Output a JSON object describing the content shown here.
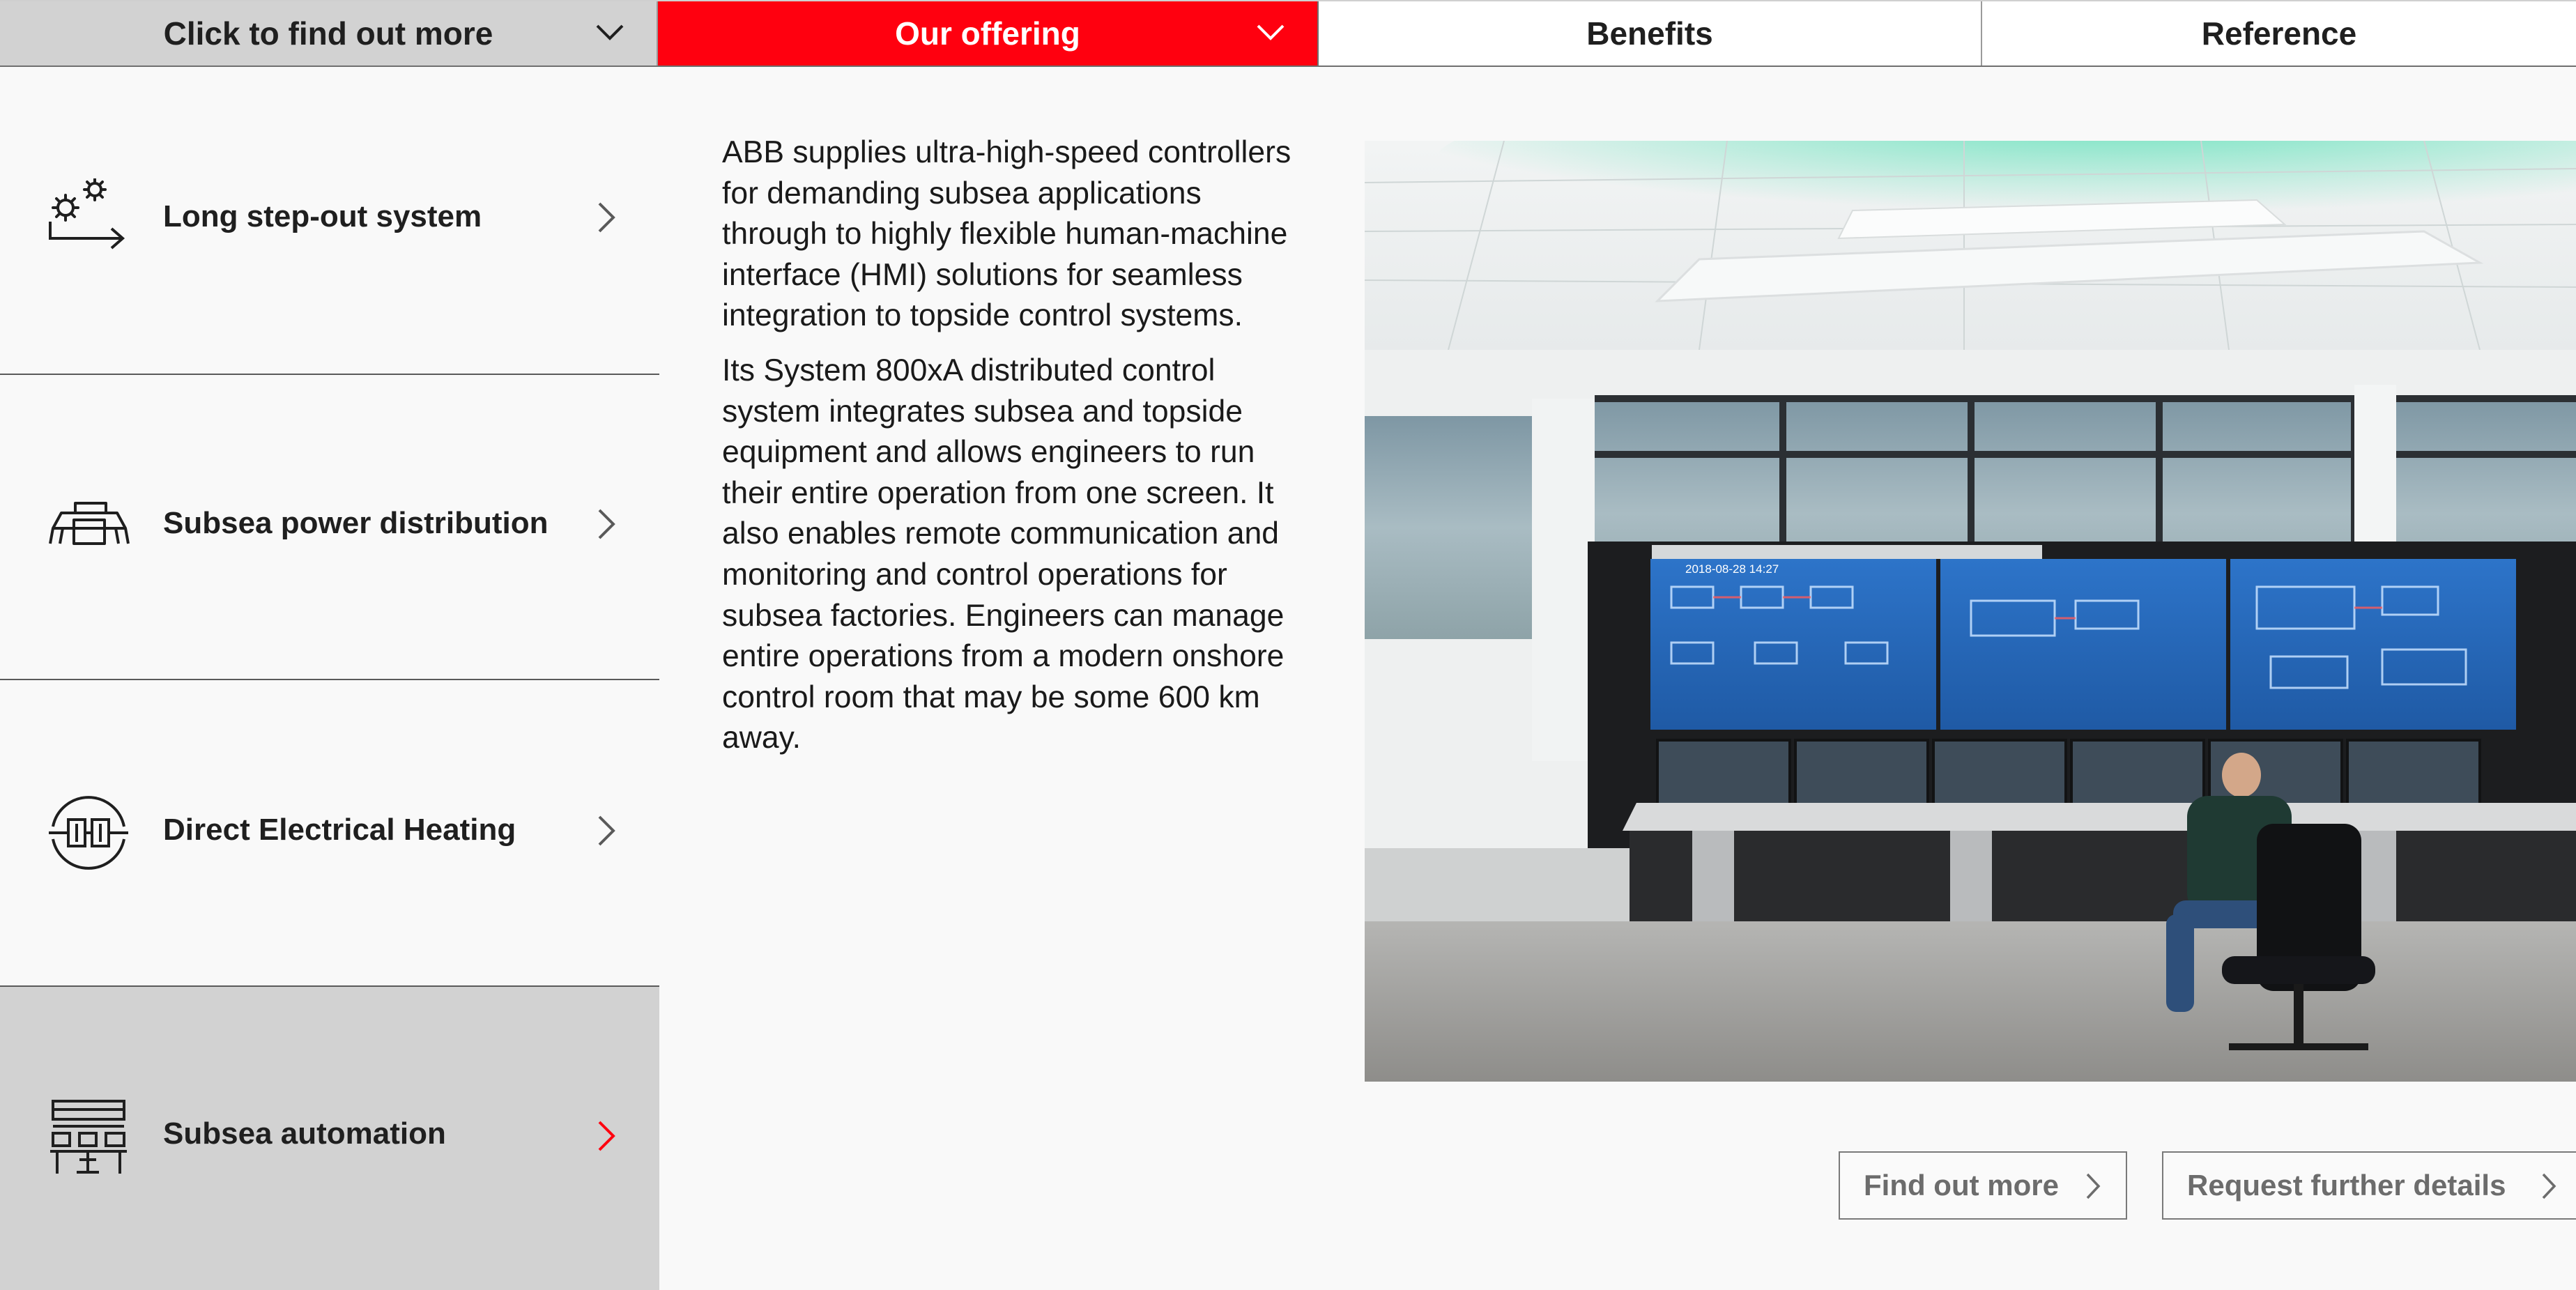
{
  "tabs": [
    {
      "label": "Click to find out more",
      "has_dropdown": true,
      "state": "default"
    },
    {
      "label": "Our offering",
      "has_dropdown": true,
      "state": "active"
    },
    {
      "label": "Benefits",
      "has_dropdown": false,
      "state": "default"
    },
    {
      "label": "Reference",
      "has_dropdown": false,
      "state": "default"
    }
  ],
  "sidebar": {
    "items": [
      {
        "label": "Long step-out system",
        "icon": "gears-arrow-icon",
        "active": false
      },
      {
        "label": "Subsea power distribution",
        "icon": "subsea-module-icon",
        "active": false
      },
      {
        "label": "Direct Electrical Heating",
        "icon": "heating-circle-icon",
        "active": false
      },
      {
        "label": "Subsea automation",
        "icon": "control-desk-icon",
        "active": true
      }
    ]
  },
  "content": {
    "paragraph1": "ABB supplies ultra-high-speed controllers for demanding subsea applications through to highly flexible human-machine interface (HMI) solutions for seamless integration to topside control systems.",
    "paragraph2": "Its System 800xA distributed control system integrates subsea and topside equipment and allows engineers to run their entire operation from one screen. It also enables remote communication and monitoring and control operations for subsea factories. Engineers can manage entire operations from a modern onshore control room that may be some 600 km away."
  },
  "photo": {
    "screen_stamp": "2018-08-28 14:27"
  },
  "buttons": {
    "find_out_more": "Find out more",
    "request_details": "Request further details"
  },
  "colors": {
    "brand_red": "#ff000f",
    "tab_gray": "#d2d2d2",
    "active_item_gray": "#d2d2d2",
    "background": "#f9f9f9",
    "ceiling_light": "#5ee0b8"
  }
}
